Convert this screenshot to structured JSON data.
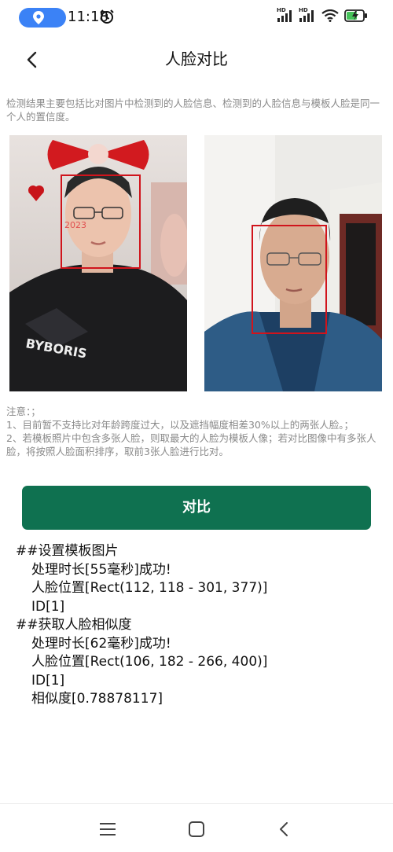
{
  "status_bar": {
    "time": "11:18",
    "signal_1_label": "HD",
    "signal_2_label": "HD",
    "icons": [
      "location-icon",
      "alarm-icon",
      "signal-icon",
      "wifi-icon",
      "battery-charging-icon"
    ]
  },
  "header": {
    "title": "人脸对比",
    "back_icon": "back-arrow-icon"
  },
  "description": "检测结果主要包括比对图片中检测到的人脸信息、检测到的人脸信息与模板人脸是同一个人的置信度。",
  "images": {
    "left_caption_text": "BYBORIS",
    "left_sticker_text": "2023",
    "face_box_color": "#d0141c"
  },
  "notes": {
    "heading": "注意：；",
    "item1": "1、目前暂不支持比对年龄跨度过大，以及遮挡幅度相差30%以上的两张人脸。；",
    "item2": "2、若模板照片中包含多张人脸，则取最大的人脸为模板人像；若对比图像中有多张人脸，将按照人脸面积排序，取前3张人脸进行比对。"
  },
  "compare_button": {
    "label": "对比",
    "color": "#0f7150"
  },
  "log": {
    "template_heading": "##设置模板图片",
    "template_time": "处理时长[55毫秒]成功!",
    "template_rect": "人脸位置[Rect(112, 118 - 301, 377)]",
    "template_id": "ID[1]",
    "similarity_heading": "##获取人脸相似度",
    "similarity_time": "处理时长[62毫秒]成功!",
    "similarity_rect": "人脸位置[Rect(106, 182 - 266, 400)]",
    "similarity_id": "ID[1]",
    "similarity_value": "相似度[0.78878117]"
  },
  "nav_bar": {
    "icons": [
      "menu-icon",
      "home-icon",
      "back-icon"
    ]
  }
}
